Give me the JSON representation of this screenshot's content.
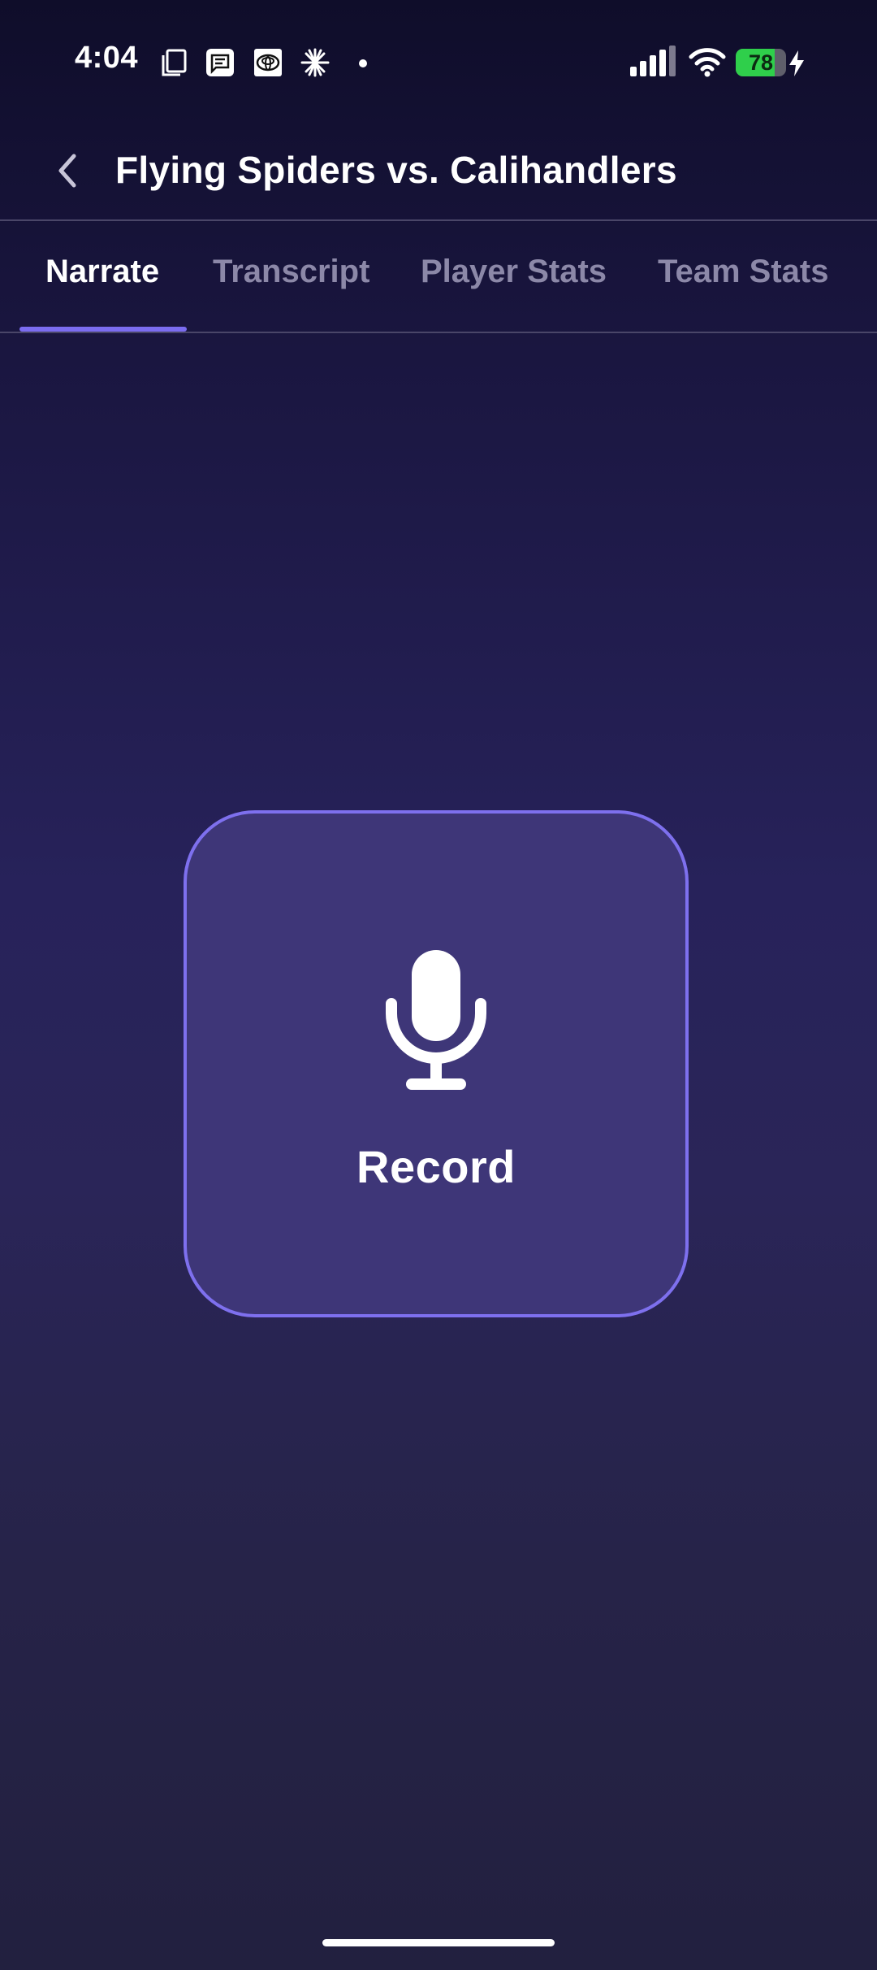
{
  "status_bar": {
    "time": "4:04",
    "battery_level": 78,
    "battery_label": "78",
    "left_icons": [
      "copy-icon",
      "message-icon",
      "toyota-icon",
      "sparkle-icon",
      "dot-icon"
    ],
    "right_icons": [
      "signal-icon",
      "wifi-icon",
      "battery-icon",
      "charging-icon"
    ],
    "battery_color": "#2fcf4b"
  },
  "header": {
    "back_icon": "chevron-left-icon",
    "title": "Flying Spiders vs. Calihandlers"
  },
  "tabs": [
    {
      "label": "Narrate",
      "active": true
    },
    {
      "label": "Transcript",
      "active": false
    },
    {
      "label": "Player Stats",
      "active": false
    },
    {
      "label": "Team Stats",
      "active": false
    }
  ],
  "record": {
    "icon": "microphone-icon",
    "label": "Record"
  },
  "colors": {
    "accent": "#7b6cf0",
    "background_top": "#0f0d2a",
    "background_mid": "#27225a",
    "button_fill": "#3e3678",
    "inactive_tab": "#8c88a8"
  }
}
